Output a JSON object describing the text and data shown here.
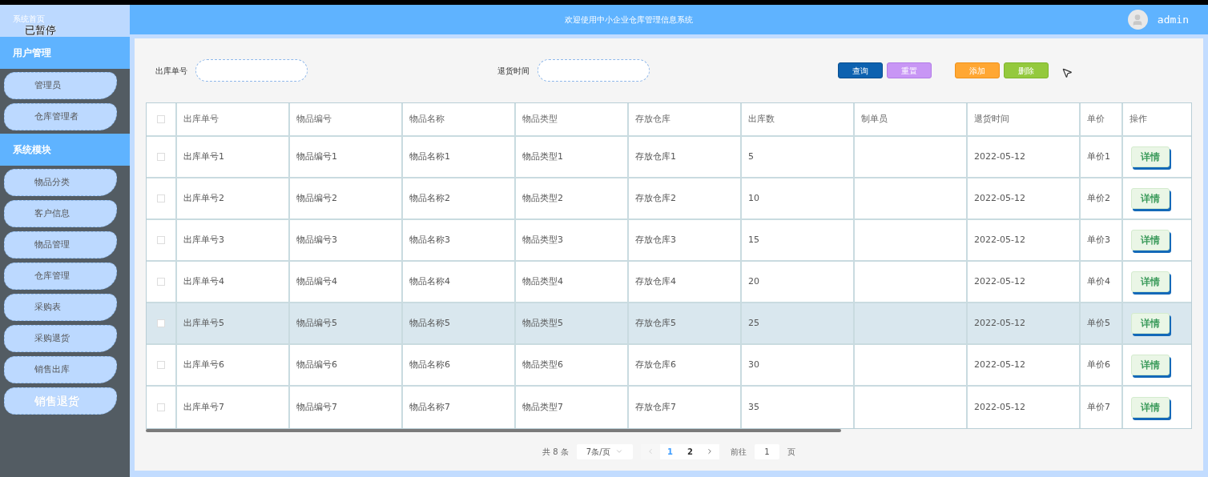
{
  "sidebar": {
    "home": "系统首页",
    "overlay": "已暂停",
    "sections": [
      {
        "title": "用户管理",
        "items": [
          {
            "label": "管理员",
            "selected": false
          },
          {
            "label": "仓库管理者",
            "selected": false
          }
        ]
      },
      {
        "title": "系统模块",
        "items": [
          {
            "label": "物品分类",
            "selected": false
          },
          {
            "label": "客户信息",
            "selected": false
          },
          {
            "label": "物品管理",
            "selected": false
          },
          {
            "label": "仓库管理",
            "selected": false
          },
          {
            "label": "采购表",
            "selected": false
          },
          {
            "label": "采购退货",
            "selected": false
          },
          {
            "label": "销售出库",
            "selected": false
          },
          {
            "label": "销售退货",
            "selected": true
          }
        ]
      }
    ]
  },
  "header": {
    "title": "欢迎使用中小企业仓库管理信息系统",
    "user": "admin"
  },
  "filters": [
    {
      "label": "出库单号"
    },
    {
      "label": "退货时间"
    }
  ],
  "buttons": [
    {
      "label": "查询",
      "kind": "query"
    },
    {
      "label": "重置",
      "kind": "reset"
    },
    {
      "label": "添加",
      "kind": "add"
    },
    {
      "label": "删除",
      "kind": "delete"
    }
  ],
  "table": {
    "select_all_checked": false,
    "columns": [
      "出库单号",
      "物品编号",
      "物品名称",
      "物品类型",
      "存放仓库",
      "出库数",
      "制单员",
      "退货时间",
      "单价",
      "操作"
    ],
    "rows": [
      {
        "cells": [
          "出库单号1",
          "物品编号1",
          "物品名称1",
          "物品类型1",
          "存放仓库1",
          "5",
          "",
          "2022-05-12",
          "单价1"
        ],
        "action": "详情",
        "checked": false,
        "hovered": false
      },
      {
        "cells": [
          "出库单号2",
          "物品编号2",
          "物品名称2",
          "物品类型2",
          "存放仓库2",
          "10",
          "",
          "2022-05-12",
          "单价2"
        ],
        "action": "详情",
        "checked": false,
        "hovered": false
      },
      {
        "cells": [
          "出库单号3",
          "物品编号3",
          "物品名称3",
          "物品类型3",
          "存放仓库3",
          "15",
          "",
          "2022-05-12",
          "单价3"
        ],
        "action": "详情",
        "checked": false,
        "hovered": false
      },
      {
        "cells": [
          "出库单号4",
          "物品编号4",
          "物品名称4",
          "物品类型4",
          "存放仓库4",
          "20",
          "",
          "2022-05-12",
          "单价4"
        ],
        "action": "详情",
        "checked": false,
        "hovered": false
      },
      {
        "cells": [
          "出库单号5",
          "物品编号5",
          "物品名称5",
          "物品类型5",
          "存放仓库5",
          "25",
          "",
          "2022-05-12",
          "单价5"
        ],
        "action": "详情",
        "checked": false,
        "hovered": true
      },
      {
        "cells": [
          "出库单号6",
          "物品编号6",
          "物品名称6",
          "物品类型6",
          "存放仓库6",
          "30",
          "",
          "2022-05-12",
          "单价6"
        ],
        "action": "详情",
        "checked": false,
        "hovered": false
      },
      {
        "cells": [
          "出库单号7",
          "物品编号7",
          "物品名称7",
          "物品类型7",
          "存放仓库7",
          "35",
          "",
          "2022-05-12",
          "单价7"
        ],
        "action": "详情",
        "checked": false,
        "hovered": false
      }
    ]
  },
  "pagination": {
    "total": "共 8 条",
    "page_size": "7条/页",
    "pages": [
      {
        "label": "1",
        "selected": true
      },
      {
        "label": "2",
        "selected": false
      }
    ],
    "goto_label": "前往",
    "goto_value": "1",
    "goto_suffix": "页"
  }
}
